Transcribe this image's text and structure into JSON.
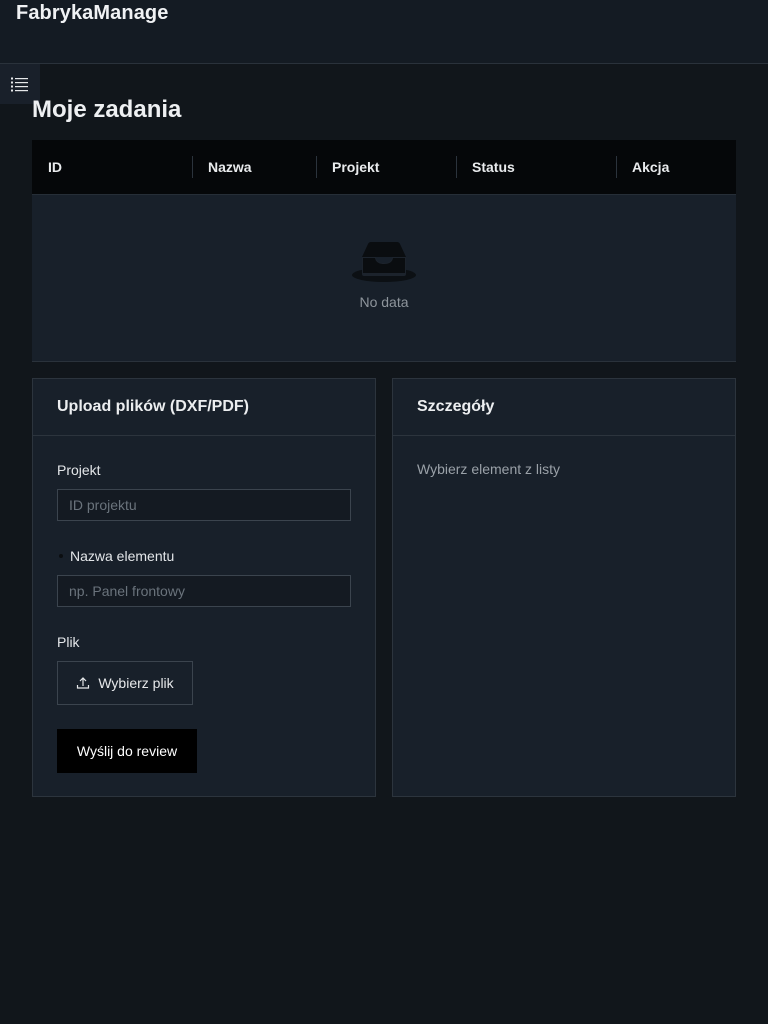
{
  "app": {
    "title": "FabrykaManage"
  },
  "page": {
    "title": "Moje zadania"
  },
  "table": {
    "columns": [
      "ID",
      "Nazwa",
      "Projekt",
      "Status",
      "Akcja"
    ],
    "rows": [],
    "empty_text": "No data"
  },
  "upload": {
    "title": "Upload plików (DXF/PDF)",
    "project_label": "Projekt",
    "project_placeholder": "ID projektu",
    "project_value": "",
    "element_label": "Nazwa elementu",
    "element_placeholder": "np. Panel frontowy",
    "element_value": "",
    "file_label": "Plik",
    "file_button": "Wybierz plik",
    "submit_button": "Wyślij do review"
  },
  "details": {
    "title": "Szczegóły",
    "hint": "Wybierz element z listy"
  },
  "icons": {
    "menu": "menu-list-icon",
    "empty": "empty-inbox-icon",
    "upload": "upload-icon"
  },
  "colors": {
    "background": "#11161b",
    "header": "#141b23",
    "table_header": "#050709",
    "card": "#18202a",
    "primary_button": "#000000"
  }
}
